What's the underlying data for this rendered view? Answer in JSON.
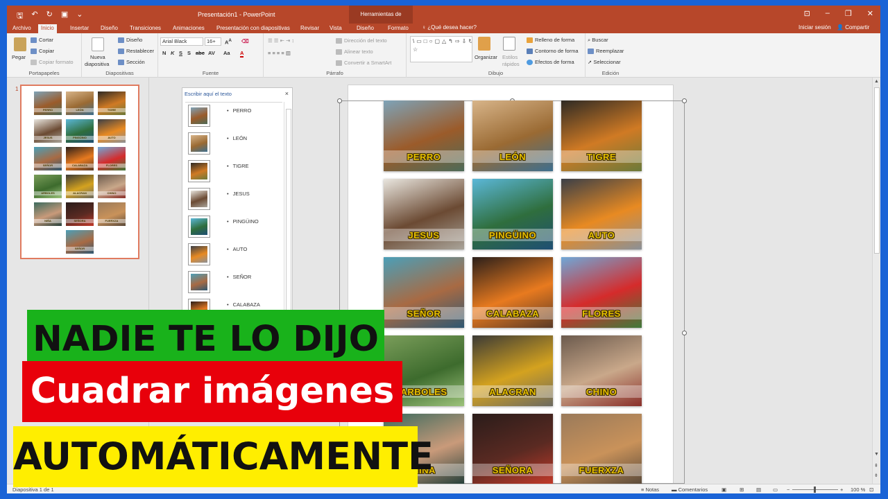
{
  "window": {
    "title": "Presentación1 - PowerPoint",
    "contextual_tab_group": "Herramientas de SmartArt",
    "controls": [
      "⊡",
      "–",
      "❐",
      "✕"
    ]
  },
  "qat": {
    "save_icon": "save-icon",
    "undo_icon": "undo-icon",
    "redo_icon": "redo-icon"
  },
  "tabs": [
    "Archivo",
    "Inicio",
    "Insertar",
    "Diseño",
    "Transiciones",
    "Animaciones",
    "Presentación con diapositivas",
    "Revisar",
    "Vista",
    "Diseño",
    "Formato"
  ],
  "active_tab": "Inicio",
  "tell_me": "¿Qué desea hacer?",
  "sign_in": "Iniciar sesión",
  "share": "Compartir",
  "ribbon": {
    "portapapeles": {
      "label": "Portapapeles",
      "paste": "Pegar",
      "cut": "Cortar",
      "copy": "Copiar",
      "format_painter": "Copiar formato"
    },
    "diapositivas": {
      "label": "Diapositivas",
      "new_slide_1": "Nueva",
      "new_slide_2": "diapositiva",
      "layout": "Diseño",
      "reset": "Restablecer",
      "section": "Sección"
    },
    "fuente": {
      "label": "Fuente",
      "font_name": "Arial Black",
      "font_size": "16+",
      "buttons": [
        "N",
        "K",
        "S",
        "S",
        "abc",
        "AV",
        "Aa",
        "A"
      ]
    },
    "parrafo": {
      "label": "Párrafo",
      "text_direction": "Dirección del texto",
      "align_text": "Alinear texto",
      "convert_smartart": "Convertir a SmartArt"
    },
    "dibujo": {
      "label": "Dibujo",
      "arrange": "Organizar",
      "quick_styles_1": "Estilos",
      "quick_styles_2": "rápidos",
      "shape_fill": "Relleno de forma",
      "shape_outline": "Contorno de forma",
      "shape_effects": "Efectos de forma",
      "shapes_preview": "\\▭□○▢△↰⇨⇩↻⌒{}☆"
    },
    "edicion": {
      "label": "Edición",
      "find": "Buscar",
      "replace": "Reemplazar",
      "select": "Seleccionar"
    }
  },
  "slide_panel": {
    "slide_number": "1",
    "thumbnail_labels": [
      "PERRO",
      "LEÓN",
      "TIGRE",
      "JESUS",
      "PINGÜINO",
      "AUTO",
      "SEÑOR",
      "CALABAZA",
      "FLORES",
      "ARBOLES",
      "ALACRAN",
      "CHINO",
      "NIÑA",
      "SEÑORA",
      "FUERXZA",
      "SEÑOR"
    ]
  },
  "text_pane": {
    "title": "Escribir aquí el texto",
    "close": "×",
    "items": [
      "PERRO",
      "LEÓN",
      "TIGRE",
      "JESUS",
      "PINGÜINO",
      "AUTO",
      "SEÑOR",
      "CALABAZA"
    ]
  },
  "smartart_items": [
    {
      "label": "PERRO",
      "colors": [
        "#7ea3b8",
        "#9b5b2a",
        "#4d6b58"
      ]
    },
    {
      "label": "LEÓN",
      "colors": [
        "#d7b489",
        "#9a6a33",
        "#3e6f8e"
      ]
    },
    {
      "label": "TIGRE",
      "colors": [
        "#2e2a24",
        "#d07a24",
        "#6b7a3a"
      ]
    },
    {
      "label": "JESUS",
      "colors": [
        "#e9e6df",
        "#6b4a33",
        "#a9a49a"
      ]
    },
    {
      "label": "PINGÜINO",
      "colors": [
        "#5bb7d8",
        "#2f6e3d",
        "#1f4f74"
      ]
    },
    {
      "label": "AUTO",
      "colors": [
        "#3b3f47",
        "#e88a22",
        "#8b9198"
      ]
    },
    {
      "label": "SEÑOR",
      "colors": [
        "#4b9fb8",
        "#a86a43",
        "#2f5872"
      ]
    },
    {
      "label": "CALABAZA",
      "colors": [
        "#2b1f1a",
        "#e87a1f",
        "#5a3a26"
      ]
    },
    {
      "label": "FLORES",
      "colors": [
        "#6fa8d8",
        "#d52b2b",
        "#3f7a3a"
      ]
    },
    {
      "label": "ARBOLES",
      "colors": [
        "#7a9d5a",
        "#3d6b2d",
        "#9cc27a"
      ]
    },
    {
      "label": "ALACRAN",
      "colors": [
        "#3b3a36",
        "#d4a21f",
        "#6c6a60"
      ]
    },
    {
      "label": "CHINO",
      "colors": [
        "#6b5a4d",
        "#c9a88a",
        "#8a2f2a"
      ]
    },
    {
      "label": "NIÑA",
      "colors": [
        "#3d6b5e",
        "#c99a7a",
        "#243f3a"
      ]
    },
    {
      "label": "SEÑORA",
      "colors": [
        "#2a1c1a",
        "#5a2a22",
        "#c23a2a"
      ]
    },
    {
      "label": "FUERXZA",
      "colors": [
        "#9a7a5a",
        "#c9925a",
        "#5a4a3a"
      ]
    }
  ],
  "status_bar": {
    "slide_info": "Diapositiva 1 de 1",
    "notes": "Notas",
    "comments": "Comentarios",
    "zoom": "100 %"
  },
  "overlay": {
    "line1": "NADIE TE LO DIJO",
    "line2": "Cuadrar imágenes",
    "line3": "AUTOMÁTICAMENTE",
    "colors": {
      "green": "#19b21b",
      "red": "#e8000b",
      "yellow": "#ffee00"
    }
  }
}
